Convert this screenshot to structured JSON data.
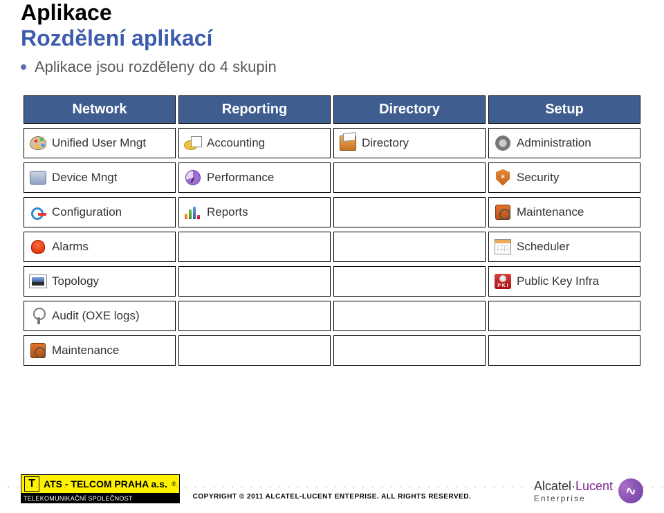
{
  "heading": {
    "title": "Aplikace",
    "subtitle": "Rozdělení aplikací"
  },
  "bullet": "Aplikace jsou rozděleny do 4 skupin",
  "table": {
    "headers": [
      "Network",
      "Reporting",
      "Directory",
      "Setup"
    ],
    "rows": [
      {
        "c0": "Unified User Mngt",
        "c1": "Accounting",
        "c2": "Directory",
        "c3": "Administration"
      },
      {
        "c0": "Device Mngt",
        "c1": "Performance",
        "c2": "",
        "c3": "Security"
      },
      {
        "c0": "Configuration",
        "c1": "Reports",
        "c2": "",
        "c3": "Maintenance"
      },
      {
        "c0": "Alarms",
        "c1": "",
        "c2": "",
        "c3": "Scheduler"
      },
      {
        "c0": "Topology",
        "c1": "",
        "c2": "",
        "c3": "Public Key Infra"
      },
      {
        "c0": "Audit (OXE logs)",
        "c1": "",
        "c2": "",
        "c3": ""
      },
      {
        "c0": "Maintenance",
        "c1": "",
        "c2": "",
        "c3": ""
      }
    ]
  },
  "footer": {
    "ats_name": "ATS - TELCOM PRAHA a.s.",
    "ats_sub": "TELEKOMUNIKAČNÍ SPOLEČNOST",
    "copyright": "COPYRIGHT © 2011 ALCATEL-LUCENT ENTEPRISE.  ALL RIGHTS RESERVED.",
    "al_brand_a": "Alcatel",
    "al_brand_dot": "·",
    "al_brand_b": "Lucent",
    "al_brand_sub": "Enterprise",
    "registered": "®"
  },
  "pki_label": "P K I"
}
